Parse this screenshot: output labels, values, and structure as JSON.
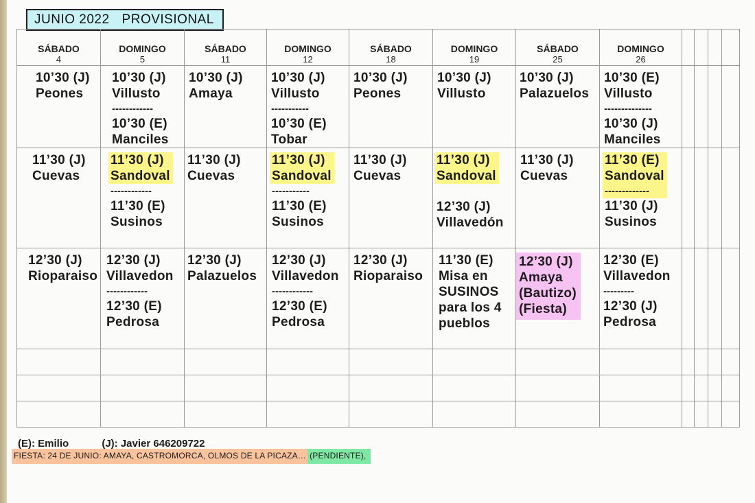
{
  "title": {
    "month": "JUNIO 2022",
    "status": "PROVISIONAL"
  },
  "days": [
    {
      "name": "SÁBADO",
      "num": "4"
    },
    {
      "name": "DOMINGO",
      "num": "5"
    },
    {
      "name": "SÁBADO",
      "num": "11"
    },
    {
      "name": "DOMINGO",
      "num": "12"
    },
    {
      "name": "SÁBADO",
      "num": "18"
    },
    {
      "name": "DOMINGO",
      "num": "19"
    },
    {
      "name": "SÁBADO",
      "num": "25"
    },
    {
      "name": "DOMINGO",
      "num": "26"
    }
  ],
  "row1": [
    [
      "10’30 (J)",
      "Peones"
    ],
    [
      "10’30 (J)",
      "Villusto",
      "------------",
      "10’30 (E)",
      "Manciles"
    ],
    [
      "10’30 (J)",
      "Amaya"
    ],
    [
      "10’30 (J)",
      "Villusto",
      "-----------",
      "10’30 (E)",
      "Tobar"
    ],
    [
      "10’30 (J)",
      "Peones"
    ],
    [
      "10’30 (J)",
      "Villusto"
    ],
    [
      "10’30 (J)",
      "Palazuelos"
    ],
    [
      "10’30 (E)",
      "Villusto",
      "--------------",
      "10’30 (J)",
      "Manciles"
    ]
  ],
  "row2": [
    [
      "11’30 (J)",
      "Cuevas"
    ],
    [
      "11’30 (J)",
      "Sandoval",
      "------------",
      "11’30 (E)",
      "Susinos"
    ],
    [
      "11’30 (J)",
      "Cuevas"
    ],
    [
      "11’30 (J)",
      "Sandoval",
      "-----------",
      "11’30 (E)",
      "Susinos"
    ],
    [
      "11’30 (J)",
      "Cuevas"
    ],
    [
      "11’30 (J)",
      "Sandoval",
      "12’30 (J)",
      "Villavedón"
    ],
    [
      "11’30 (J)",
      "Cuevas"
    ],
    [
      "11’30 (E)",
      "Sandoval",
      "-------------",
      "11’30 (J)",
      "Susinos"
    ]
  ],
  "row3": [
    [
      "12’30 (J)",
      "Rioparaiso"
    ],
    [
      "12’30 (J)",
      "Villavedon",
      "------------",
      "12’30 (E)",
      "Pedrosa"
    ],
    [
      "12’30 (J)",
      "Palazuelos"
    ],
    [
      "12’30 (J)",
      "Villavedon",
      "------------",
      "12’30 (E)",
      "Pedrosa"
    ],
    [
      "12’30 (J)",
      "Rioparaiso"
    ],
    [
      "11’30 (E)",
      "Misa en",
      "SUSINOS",
      "para los 4",
      "pueblos"
    ],
    [
      "12’30 (J)",
      "Amaya",
      "(Bautizo)",
      "(Fiesta)"
    ],
    [
      "12’30 (E)",
      "Villavedon",
      "---------",
      "12’30 (J)",
      "Pedrosa"
    ]
  ],
  "legend": {
    "emilio": "(E): Emilio",
    "javier": "(J): Javier 646209722"
  },
  "fiesta": {
    "text": "FIESTA: 24 DE JUNIO: AMAYA, CASTROMORCA, OLMOS DE LA PICAZA…",
    "status": "(PENDIENTE),"
  },
  "colors": {
    "highlight_yellow": "#fbf58a",
    "highlight_pink": "#f6c2f1",
    "title_bg": "#c9f2f6",
    "fiesta_orange": "#f8c39d",
    "pendiente_green": "#7ee8a4"
  }
}
